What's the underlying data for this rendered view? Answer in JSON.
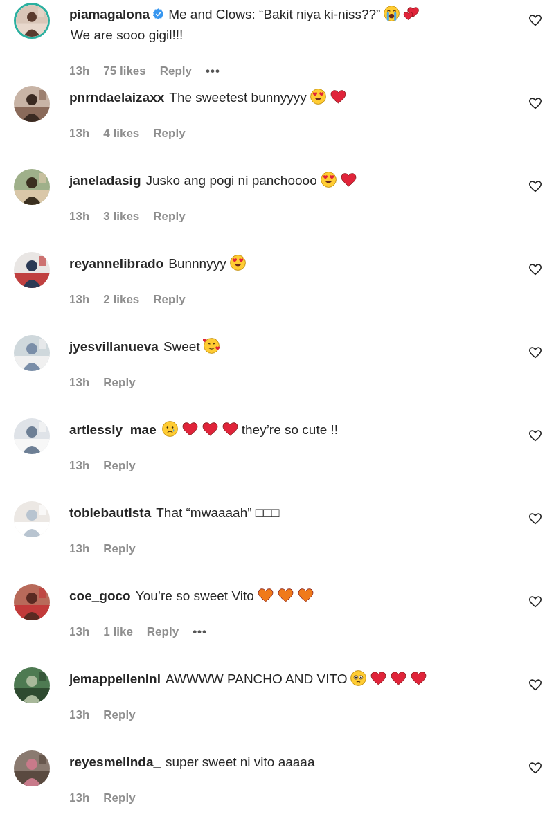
{
  "comments": [
    {
      "username": "piamagalona",
      "verified": true,
      "avatar_ring": true,
      "segments": [
        {
          "kind": "text",
          "text": "Me and Clows: “Bakit niya ki-niss??”"
        },
        {
          "kind": "face-sob"
        },
        {
          "kind": "hearts",
          "color": "#e0243a"
        },
        {
          "kind": "text",
          "text": "We are sooo gigil!!!"
        }
      ],
      "time": "13h",
      "likes": "75 likes",
      "reply": "Reply",
      "more": "•••"
    },
    {
      "username": "pnrndaelaizaxx",
      "verified": false,
      "avatar_ring": false,
      "segments": [
        {
          "kind": "text",
          "text": "The sweetest bunnyyyy"
        },
        {
          "kind": "face-heart-eyes"
        },
        {
          "kind": "heart",
          "color": "#e0243a"
        }
      ],
      "time": "13h",
      "likes": "4 likes",
      "reply": "Reply"
    },
    {
      "username": "janeladasig",
      "verified": false,
      "avatar_ring": false,
      "segments": [
        {
          "kind": "text",
          "text": "Jusko ang pogi ni panchoooo"
        },
        {
          "kind": "face-heart-eyes"
        },
        {
          "kind": "heart",
          "color": "#e0243a"
        }
      ],
      "time": "13h",
      "likes": "3 likes",
      "reply": "Reply"
    },
    {
      "username": "reyannelibrado",
      "verified": false,
      "avatar_ring": false,
      "segments": [
        {
          "kind": "text",
          "text": "Bunnnyyy"
        },
        {
          "kind": "face-heart-eyes"
        }
      ],
      "time": "13h",
      "likes": "2 likes",
      "reply": "Reply"
    },
    {
      "username": "jyesvillanueva",
      "verified": false,
      "avatar_ring": false,
      "segments": [
        {
          "kind": "text",
          "text": "Sweet"
        },
        {
          "kind": "face-hearts"
        }
      ],
      "time": "13h",
      "reply": "Reply"
    },
    {
      "username": "artlessly_mae",
      "verified": false,
      "avatar_ring": false,
      "segments": [
        {
          "kind": "face-tear"
        },
        {
          "kind": "heart",
          "color": "#e0243a"
        },
        {
          "kind": "heart",
          "color": "#e0243a"
        },
        {
          "kind": "heart",
          "color": "#e0243a"
        },
        {
          "kind": "text",
          "text": "they’re so cute !!"
        }
      ],
      "time": "13h",
      "reply": "Reply"
    },
    {
      "username": "tobiebautista",
      "verified": false,
      "avatar_ring": false,
      "segments": [
        {
          "kind": "text",
          "text": "That “mwaaaah” □□□"
        }
      ],
      "time": "13h",
      "reply": "Reply"
    },
    {
      "username": "coe_goco",
      "verified": false,
      "avatar_ring": false,
      "segments": [
        {
          "kind": "text",
          "text": "You’re so sweet Vito"
        },
        {
          "kind": "heart",
          "color": "#f07a1a"
        },
        {
          "kind": "heart",
          "color": "#f07a1a"
        },
        {
          "kind": "heart",
          "color": "#f07a1a"
        }
      ],
      "time": "13h",
      "likes": "1 like",
      "reply": "Reply",
      "more": "•••"
    },
    {
      "username": "jemappellenini",
      "verified": false,
      "avatar_ring": false,
      "segments": [
        {
          "kind": "text",
          "text": "AWWWW PANCHO AND VITO"
        },
        {
          "kind": "face-pleading"
        },
        {
          "kind": "heart",
          "color": "#e0243a"
        },
        {
          "kind": "heart",
          "color": "#e0243a"
        },
        {
          "kind": "heart",
          "color": "#e0243a"
        }
      ],
      "time": "13h",
      "reply": "Reply"
    },
    {
      "username": "reyesmelinda_",
      "verified": false,
      "avatar_ring": false,
      "segments": [
        {
          "kind": "text",
          "text": "super sweet ni vito aaaaa"
        }
      ],
      "time": "13h",
      "reply": "Reply"
    }
  ]
}
